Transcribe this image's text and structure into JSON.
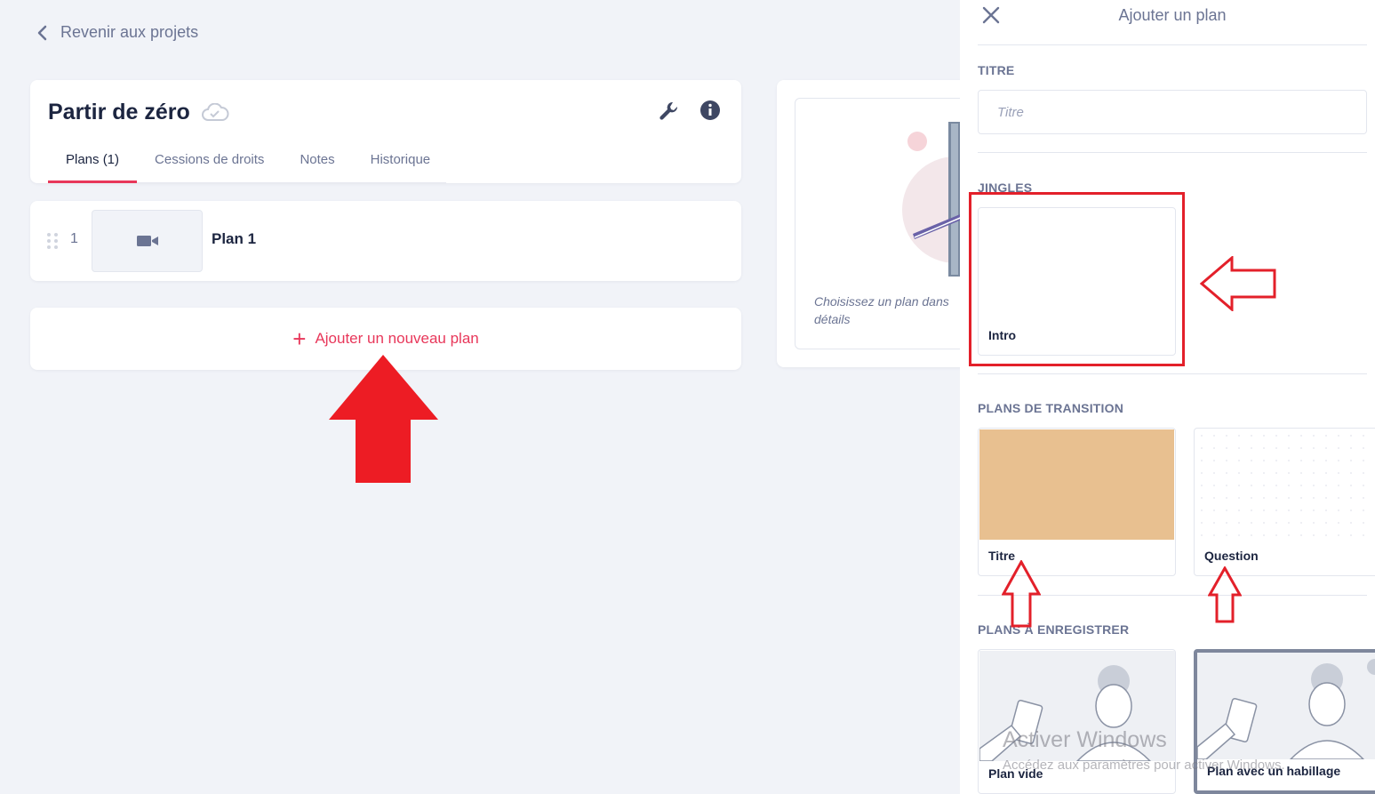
{
  "back_link": {
    "label": "Revenir aux projets"
  },
  "project": {
    "title": "Partir de zéro",
    "tabs": [
      {
        "label": "Plans (1)",
        "active": true
      },
      {
        "label": "Cessions de droits",
        "active": false
      },
      {
        "label": "Notes",
        "active": false
      },
      {
        "label": "Historique",
        "active": false
      }
    ]
  },
  "plans": [
    {
      "number": "1",
      "name": "Plan 1",
      "icon": "video-camera-icon"
    }
  ],
  "add_plan": {
    "label": "Ajouter un nouveau plan"
  },
  "detail": {
    "hint": "Choisissez un plan dans",
    "hint_line2": "détails"
  },
  "panel": {
    "title": "Ajouter un plan",
    "titre_section": "TITRE",
    "titre_placeholder": "Titre",
    "jingles_section": "JINGLES",
    "jingles": [
      {
        "label": "Intro"
      }
    ],
    "transition_section": "PLANS DE TRANSITION",
    "transitions": [
      {
        "label": "Titre",
        "color": "#e8c090"
      },
      {
        "label": "Question",
        "color": "#ffffff"
      }
    ],
    "record_section": "PLANS À ENREGISTRER",
    "record_plans": [
      {
        "label": "Plan vide"
      },
      {
        "label": "Plan avec un habillage"
      }
    ]
  },
  "watermark": {
    "title": "Activer Windows",
    "subtitle": "Accédez aux paramètres pour activer Windows."
  },
  "colors": {
    "accent": "#e8375a",
    "annotation_red": "#e3202a",
    "background": "#f1f3f8",
    "muted_text": "#6b7493"
  }
}
